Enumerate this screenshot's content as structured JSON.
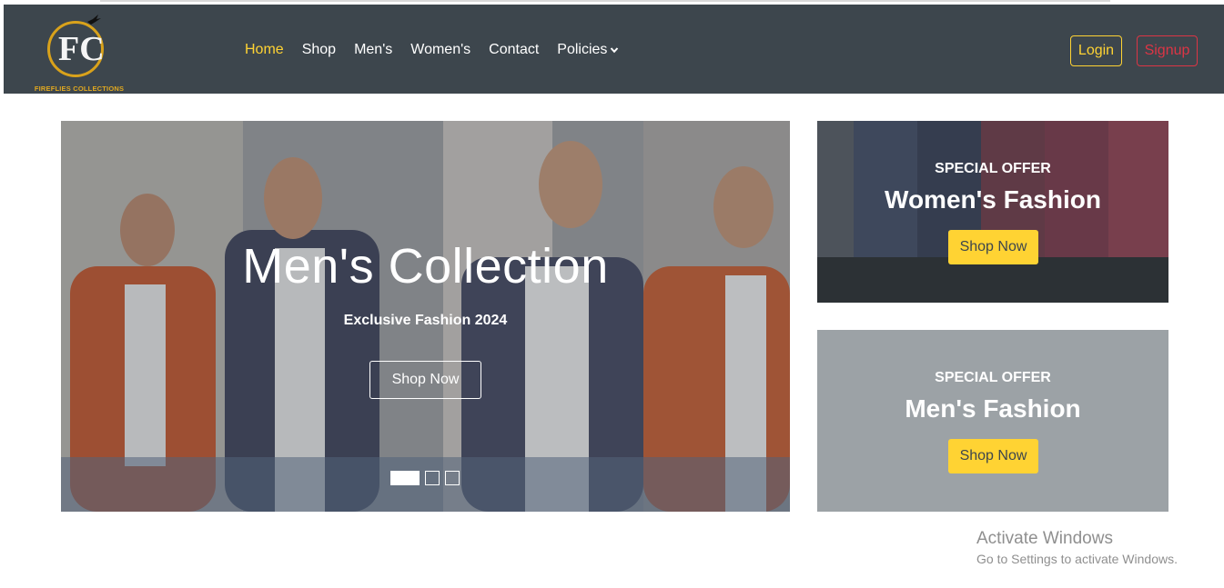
{
  "brand": {
    "logo_text": "FIREFLIES COLLECTIONS",
    "monogram": "FC",
    "accent_color": "#ffd333",
    "navbar_color": "#3d464d"
  },
  "nav": {
    "items": [
      {
        "label": "Home",
        "active": true
      },
      {
        "label": "Shop",
        "active": false
      },
      {
        "label": "Men's",
        "active": false
      },
      {
        "label": "Women's",
        "active": false
      },
      {
        "label": "Contact",
        "active": false
      },
      {
        "label": "Policies",
        "active": false,
        "icon": "chevron-down-icon"
      }
    ],
    "login_label": "Login",
    "signup_label": "Signup"
  },
  "hero": {
    "title": "Men's Collection",
    "subtitle": "Exclusive Fashion 2024",
    "button_label": "Shop Now",
    "slides_count": 3,
    "active_slide": 1
  },
  "offers": [
    {
      "kicker": "SPECIAL OFFER",
      "title": "Women's Fashion",
      "button_label": "Shop Now"
    },
    {
      "kicker": "SPECIAL OFFER",
      "title": "Men's Fashion",
      "button_label": "Shop Now"
    }
  ],
  "watermark": {
    "title": "Activate Windows",
    "subtitle": "Go to Settings to activate Windows."
  }
}
